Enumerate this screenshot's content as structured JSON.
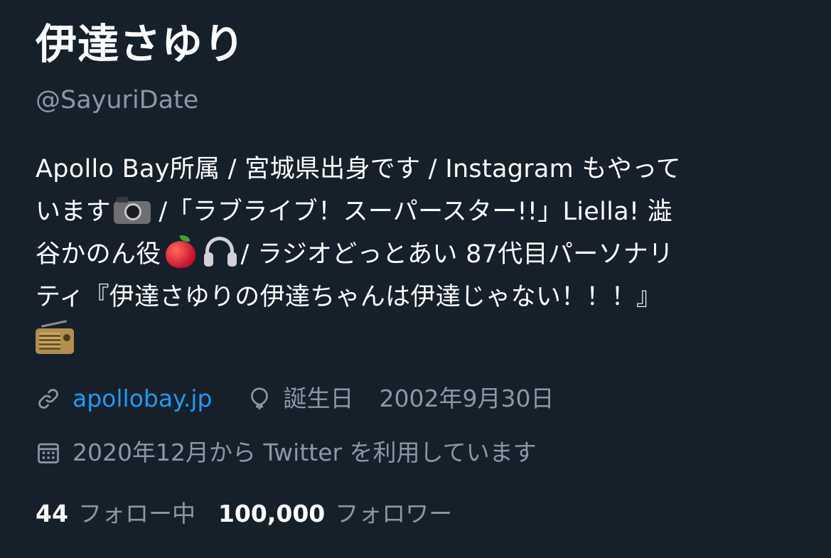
{
  "profile": {
    "display_name": "伊達さゆり",
    "handle": "@SayuriDate",
    "bio": {
      "line1": "Apollo Bay所属 / 宮城県出身です / Instagram もやって",
      "line2_a": "います",
      "line2_b": " /「ラブライブ！スーパースター!!」Liella! 澁",
      "line3_a": "谷かのん役",
      "line3_b": "/ ラジオどっとあい 87代目パーソナリ",
      "line4": "ティ『伊達さゆりの伊達ちゃんは伊達じゃない！！！』"
    },
    "emoji": {
      "camera": "camera-emoji",
      "apple": "red-apple-emoji",
      "headphones": "headphones-emoji",
      "radio": "radio-emoji"
    },
    "website": "apollobay.jp",
    "birthday_label": "誕生日",
    "birthday_value": "2002年9月30日",
    "joined": "2020年12月から Twitter を利用しています",
    "following_count": "44",
    "following_label": "フォロー中",
    "followers_count": "100,000",
    "followers_label": "フォロワー"
  },
  "icons": {
    "link": "link-icon",
    "birthday": "balloon-icon",
    "joined": "calendar-icon"
  },
  "colors": {
    "background": "#15202b",
    "primary_text": "#ffffff",
    "secondary_text": "#8b98a5",
    "link": "#1d9bf0"
  }
}
